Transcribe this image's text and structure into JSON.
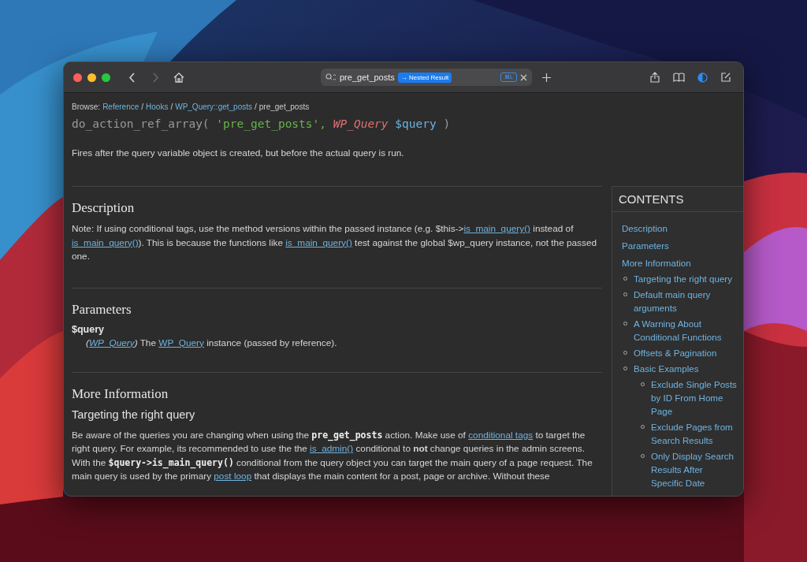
{
  "toolbar": {
    "nav_buttons": [
      {
        "kind": "back",
        "disabled": false
      },
      {
        "kind": "forward",
        "disabled": true
      },
      {
        "kind": "home",
        "disabled": false
      }
    ],
    "address_bar": {
      "value": "pre_get_posts",
      "badge": "→ Nested Result",
      "shortcut": "⌘L"
    },
    "actions": [
      {
        "kind": "share"
      },
      {
        "kind": "book"
      },
      {
        "kind": "contrast"
      },
      {
        "kind": "edit"
      }
    ]
  },
  "breadcrumb": {
    "label": "Browse:",
    "items": [
      {
        "kind": "link",
        "text": "Reference"
      },
      {
        "kind": "sep",
        "text": "/"
      },
      {
        "kind": "link",
        "text": "Hooks"
      },
      {
        "kind": "sep",
        "text": "/"
      },
      {
        "kind": "link",
        "text": "WP_Query::get_posts"
      },
      {
        "kind": "sep",
        "text": "/"
      },
      {
        "kind": "current",
        "text": "pre_get_posts"
      }
    ]
  },
  "signature": [
    {
      "kind": "fn",
      "text": "do_action_ref_array( "
    },
    {
      "kind": "string",
      "text": "'pre_get_posts', "
    },
    {
      "kind": "type",
      "text": "WP_Query "
    },
    {
      "kind": "var",
      "text": "$query "
    },
    {
      "kind": "fn",
      "text": ")"
    }
  ],
  "summary": "Fires after the query variable object is created, but before the actual query is run.",
  "sections": [
    {
      "heading": "Description",
      "blocks": [
        {
          "kind": "para",
          "parts": [
            {
              "kind": "text",
              "text": "Note: If using conditional tags, use the method versions within the passed instance (e.g. $this->"
            },
            {
              "kind": "link",
              "text": "is_main_query()"
            },
            {
              "kind": "text",
              "text": " instead of "
            },
            {
              "kind": "link",
              "text": "is_main_query()"
            },
            {
              "kind": "text",
              "text": "). This is because the functions like "
            },
            {
              "kind": "link",
              "text": "is_main_query()"
            },
            {
              "kind": "text",
              "text": " test against the global $wp_query instance, not the passed one."
            }
          ]
        }
      ]
    },
    {
      "heading": "Parameters",
      "blocks": [
        {
          "kind": "param",
          "name": "$query",
          "parts": [
            {
              "kind": "italic",
              "text": "("
            },
            {
              "kind": "typelink",
              "text": "WP_Query"
            },
            {
              "kind": "italic",
              "text": ")"
            },
            {
              "kind": "text",
              "text": " The "
            },
            {
              "kind": "link",
              "text": "WP_Query"
            },
            {
              "kind": "text",
              "text": " instance (passed by reference)."
            }
          ]
        }
      ]
    },
    {
      "heading": "More Information",
      "blocks": [
        {
          "kind": "subheading",
          "text": "Targeting the right query"
        },
        {
          "kind": "para",
          "parts": [
            {
              "kind": "text",
              "text": "Be aware of the queries you are changing when using the "
            },
            {
              "kind": "code",
              "text": "pre_get_posts"
            },
            {
              "kind": "text",
              "text": " action. Make use of "
            },
            {
              "kind": "link",
              "text": "conditional tags"
            },
            {
              "kind": "text",
              "text": " to target the right query. For example, its recommended to use the the "
            },
            {
              "kind": "link",
              "text": "is_admin()"
            },
            {
              "kind": "text",
              "text": " conditional to "
            },
            {
              "kind": "bold",
              "text": "not"
            },
            {
              "kind": "text",
              "text": " change queries in the admin screens. With the "
            },
            {
              "kind": "code",
              "text": "$query->is_main_query()"
            },
            {
              "kind": "text",
              "text": " conditional from the query object you can target the main query of a page request. The main query is used by the primary "
            },
            {
              "kind": "link",
              "text": "post loop"
            },
            {
              "kind": "text",
              "text": " that displays the main content for a post, page or archive. Without these"
            }
          ]
        }
      ]
    }
  ],
  "contents": {
    "title": "CONTENTS",
    "items": [
      {
        "label": "Description"
      },
      {
        "label": "Parameters"
      },
      {
        "label": "More Information",
        "children": [
          {
            "label": "Targeting the right query"
          },
          {
            "label": "Default main query arguments"
          },
          {
            "label": "A Warning About Conditional Functions"
          },
          {
            "label": "Offsets & Pagination"
          },
          {
            "label": "Basic Examples",
            "children": [
              {
                "label": "Exclude Single Posts by ID From Home Page"
              },
              {
                "label": "Exclude Pages from Search Results"
              },
              {
                "label": "Only Display Search Results After Specific Date"
              }
            ]
          }
        ]
      }
    ]
  }
}
